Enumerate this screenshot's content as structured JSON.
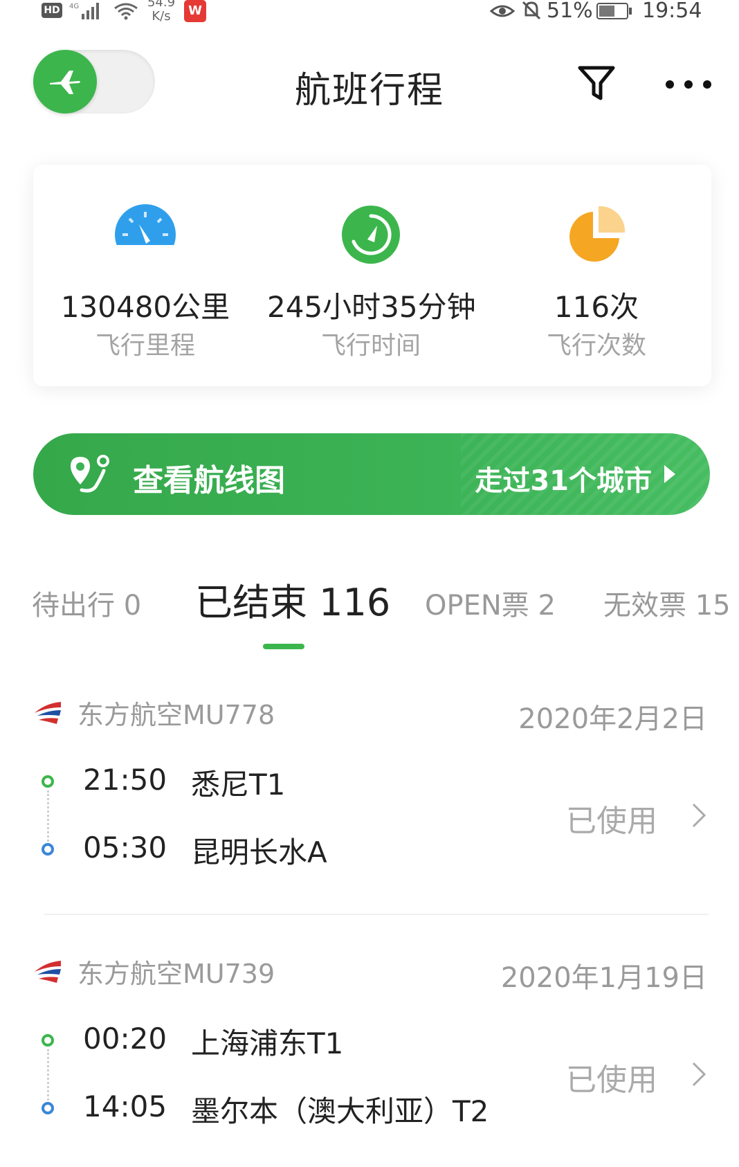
{
  "status_bar": {
    "hd": "HD",
    "net_speed": "54.9\nK/s",
    "app_badge": "W",
    "battery_pct": "51%",
    "time": "19:54"
  },
  "header": {
    "title": "航班行程"
  },
  "stats": [
    {
      "value": "130480公里",
      "label": "飞行里程",
      "icon": "speedometer-icon",
      "color": "#2f9fec"
    },
    {
      "value": "245小时35分钟",
      "label": "飞行时间",
      "icon": "timer-icon",
      "color": "#3cb64c"
    },
    {
      "value": "116次",
      "label": "飞行次数",
      "icon": "pie-icon",
      "color": "#f5a623"
    }
  ],
  "route_banner": {
    "label": "查看航线图",
    "right_text": "走过31个城市"
  },
  "tabs": [
    {
      "label": "待出行 0"
    },
    {
      "label": "已结束 116"
    },
    {
      "label": "OPEN票 2"
    },
    {
      "label": "无效票 15"
    }
  ],
  "flights": [
    {
      "airline": "东方航空MU778",
      "date": "2020年2月2日",
      "depart_time": "21:50",
      "depart_place": "悉尼T1",
      "arrive_time": "05:30",
      "arrive_place": "昆明长水A",
      "status": "已使用"
    },
    {
      "airline": "东方航空MU739",
      "date": "2020年1月19日",
      "depart_time": "00:20",
      "depart_place": "上海浦东T1",
      "arrive_time": "14:05",
      "arrive_place": "墨尔本（澳大利亚）T2",
      "status": "已使用"
    }
  ],
  "colors": {
    "accent_green": "#3cb64c",
    "arrive_blue": "#3a86d8",
    "airline_red": "#d32f2f"
  }
}
